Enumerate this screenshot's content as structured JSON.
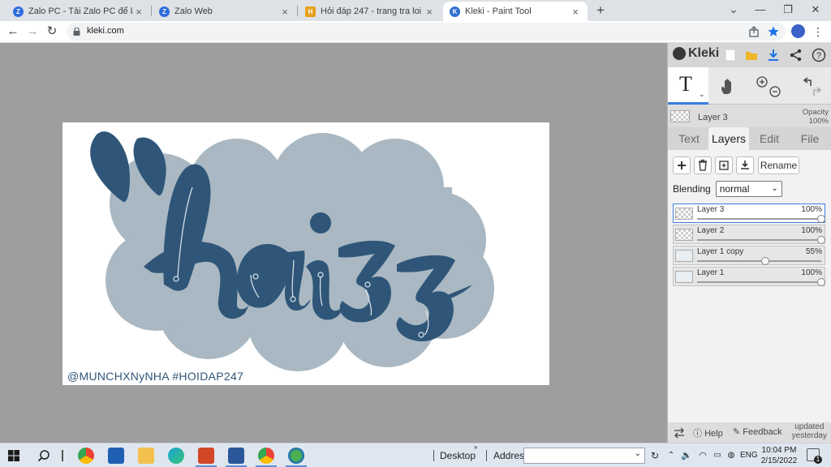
{
  "browser": {
    "tabs": [
      {
        "label": "Zalo PC - Tải Zalo PC để làm việc",
        "favicon": "zalo-favicon",
        "active": false
      },
      {
        "label": "Zalo Web",
        "favicon": "zalo-favicon",
        "active": false
      },
      {
        "label": "Hỏi đáp 247 - trang tra loi",
        "favicon": "hoidap-favicon",
        "active": false
      },
      {
        "label": "Kleki - Paint Tool",
        "favicon": "kleki-favicon",
        "active": true
      }
    ],
    "tab_close": "×",
    "new_tab": "+",
    "window_controls": {
      "chevron": "⌄",
      "minimize": "—",
      "restore": "❐",
      "close": "✕"
    },
    "url": "kleki.com",
    "nav": {
      "back": "←",
      "forward": "→",
      "reload": "↻"
    }
  },
  "canvas": {
    "watermark": "@MUNCHXNyNHA #HOIDAP247",
    "colors": {
      "cloud": "#a9b8c2",
      "ink": "#2f5678",
      "paper": "#ffffff",
      "workspace": "#9e9e9e"
    }
  },
  "panel": {
    "logo": "Kleki",
    "current_layer": {
      "name": "Layer 3",
      "opacity_label": "Opacity",
      "opacity_value": "100%"
    },
    "tabs": [
      "Text",
      "Layers",
      "Edit",
      "File"
    ],
    "active_tab": "Layers",
    "rename_label": "Rename",
    "blending_label": "Blending",
    "blending_value": "normal",
    "layers": [
      {
        "name": "Layer 3",
        "opacity": "100%",
        "opacity_value": 1.0,
        "selected": true
      },
      {
        "name": "Layer 2",
        "opacity": "100%",
        "opacity_value": 1.0,
        "selected": false
      },
      {
        "name": "Layer 1 copy",
        "opacity": "55%",
        "opacity_value": 0.55,
        "selected": false
      },
      {
        "name": "Layer 1",
        "opacity": "100%",
        "opacity_value": 1.0,
        "selected": false
      }
    ],
    "footer": {
      "help": "Help",
      "feedback": "Feedback",
      "updated_line1": "updated",
      "updated_line2": "yesterday"
    }
  },
  "taskbar": {
    "desktop_label": "Desktop",
    "address_label": "Address",
    "lang": "ENG",
    "time": "10:04 PM",
    "date": "2/15/2022",
    "notification_count": "1"
  }
}
